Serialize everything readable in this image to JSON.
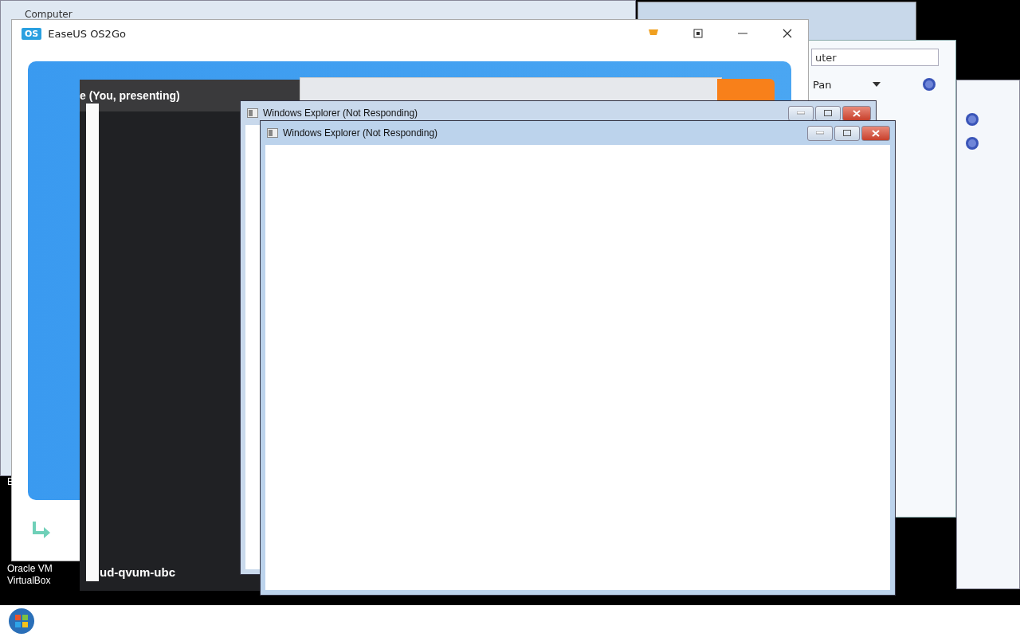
{
  "desktop": {
    "icon_labels": [
      {
        "text": "E"
      },
      {
        "text": "Oracle VM"
      },
      {
        "text": "VirtualBox"
      }
    ]
  },
  "computer_window": {
    "title": "Computer"
  },
  "back_windows": {
    "address": "uter",
    "toolbar_label": "Pan"
  },
  "easeus_window": {
    "title": "EaseUS OS2Go",
    "logo": "OS"
  },
  "meeting_overlay": {
    "presenter": "e (You, presenting)",
    "meeting_code": "ud-qvum-ubc"
  },
  "explorer_windows": [
    {
      "title": "Windows Explorer (Not Responding)",
      "selected": false
    },
    {
      "title": "Windows Explorer (Not Responding)",
      "selected": true
    }
  ]
}
